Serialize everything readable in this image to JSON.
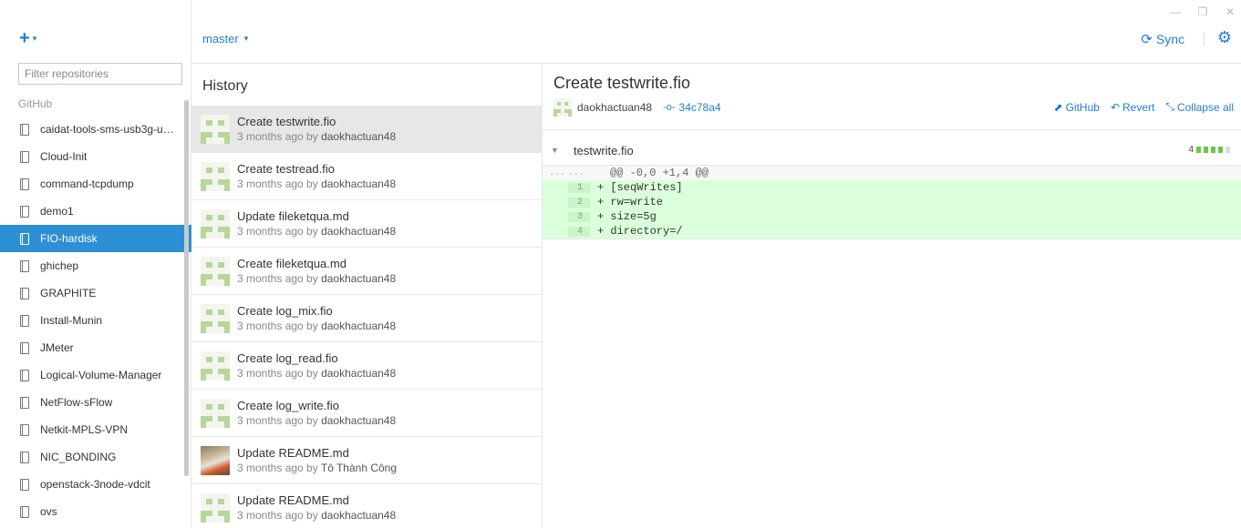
{
  "window": {
    "controls": [
      "—",
      "❐",
      "✕"
    ]
  },
  "sidebar": {
    "add_label": "+",
    "add_caret": "▾",
    "filter_placeholder": "Filter repositories",
    "section": "GitHub",
    "repos": [
      {
        "name": "caidat-tools-sms-usb3g-ubu..."
      },
      {
        "name": "Cloud-Init"
      },
      {
        "name": "command-tcpdump"
      },
      {
        "name": "demo1"
      },
      {
        "name": "FIO-hardisk",
        "active": true
      },
      {
        "name": "ghichep"
      },
      {
        "name": "GRAPHITE"
      },
      {
        "name": "Install-Munin"
      },
      {
        "name": "JMeter"
      },
      {
        "name": "Logical-Volume-Manager"
      },
      {
        "name": "NetFlow-sFlow"
      },
      {
        "name": "Netkit-MPLS-VPN"
      },
      {
        "name": "NIC_BONDING"
      },
      {
        "name": "openstack-3node-vdcit"
      },
      {
        "name": "ovs"
      }
    ]
  },
  "topbar": {
    "branch": "master",
    "branch_caret": "▾",
    "sync_icon": "⟳",
    "sync_label": "Sync",
    "settings_icon": "⚙"
  },
  "history": {
    "title": "History",
    "commits": [
      {
        "title": "Create testwrite.fio",
        "time": "3 months ago by",
        "author": "daokhactuan48",
        "selected": true
      },
      {
        "title": "Create testread.fio",
        "time": "3 months ago by",
        "author": "daokhactuan48"
      },
      {
        "title": "Update fileketqua.md",
        "time": "3 months ago by",
        "author": "daokhactuan48"
      },
      {
        "title": "Create fileketqua.md",
        "time": "3 months ago by",
        "author": "daokhactuan48"
      },
      {
        "title": "Create log_mix.fio",
        "time": "3 months ago by",
        "author": "daokhactuan48"
      },
      {
        "title": "Create log_read.fio",
        "time": "3 months ago by",
        "author": "daokhactuan48"
      },
      {
        "title": "Create log_write.fio",
        "time": "3 months ago by",
        "author": "daokhactuan48"
      },
      {
        "title": "Update README.md",
        "time": "3 months ago by",
        "author": "Tô Thành Công",
        "photo": true
      },
      {
        "title": "Update README.md",
        "time": "3 months ago by",
        "author": "daokhactuan48"
      }
    ]
  },
  "detail": {
    "title": "Create testwrite.fio",
    "author": "daokhactuan48",
    "sha_icon": "-o-",
    "sha": "34c78a4",
    "actions": {
      "github_icon": "⬈",
      "github": "GitHub",
      "revert_icon": "↶",
      "revert": "Revert",
      "collapse_icon": "⤡",
      "collapse": "Collapse all"
    },
    "file": {
      "toggle": "▼",
      "name": "testwrite.fio",
      "additions": "4"
    },
    "diff": {
      "hunk_left": "...",
      "hunk_right": "...",
      "hunk": "@@ -0,0 +1,4 @@",
      "lines": [
        {
          "num": "1",
          "code": "+ [seqWrites]"
        },
        {
          "num": "2",
          "code": "+ rw=write"
        },
        {
          "num": "3",
          "code": "+ size=5g"
        },
        {
          "num": "4",
          "code": "+ directory=/"
        }
      ]
    }
  },
  "colors": {
    "accent": "#1f7ed0",
    "active_repo": "#2d8fd4",
    "selected_commit": "#e7e7e7",
    "diff_add": "#dbffdb",
    "stat_green": "#6cc644"
  }
}
